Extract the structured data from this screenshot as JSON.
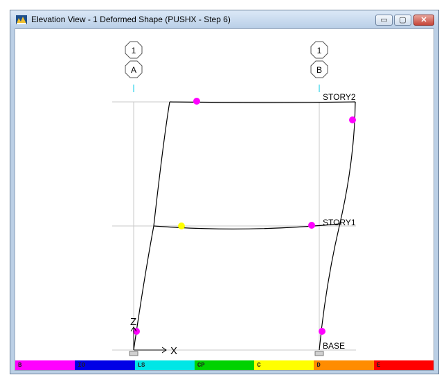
{
  "window": {
    "title": "Elevation View - 1  Deformed Shape (PUSHX - Step 6)",
    "icon": "structure-app-icon",
    "minimize_glyph": "▭",
    "maximize_glyph": "▢",
    "close_glyph": "✕"
  },
  "view": {
    "gridlines": [
      {
        "number": "1",
        "letter": "A"
      },
      {
        "number": "1",
        "letter": "B"
      }
    ],
    "stories": [
      "STORY2",
      "STORY1",
      "BASE"
    ],
    "axes": {
      "vertical": "Z",
      "horizontal": "X"
    }
  },
  "hinge_legend": [
    {
      "label": "B",
      "color": "#ff00ff"
    },
    {
      "label": "IO",
      "color": "#0000e6"
    },
    {
      "label": "LS",
      "color": "#00e6e6"
    },
    {
      "label": "CP",
      "color": "#00d200"
    },
    {
      "label": "C",
      "color": "#ffff00"
    },
    {
      "label": "D",
      "color": "#ff8c00"
    },
    {
      "label": "E",
      "color": "#ff0000"
    }
  ]
}
